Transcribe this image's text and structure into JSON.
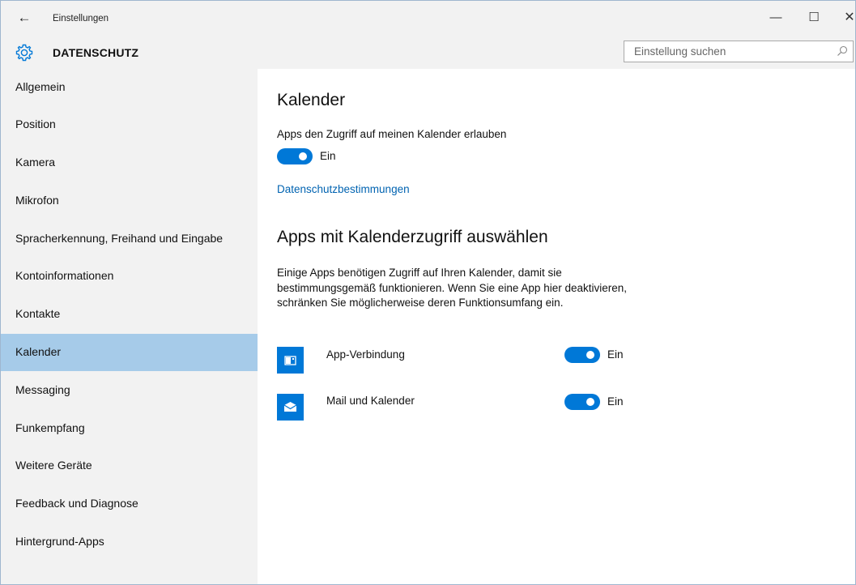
{
  "window": {
    "title": "Einstellungen",
    "back_glyph": "←",
    "minimize_glyph": "—",
    "maximize_glyph": "☐",
    "close_glyph": "✕"
  },
  "header": {
    "title": "DATENSCHUTZ",
    "icon": "gear-icon",
    "search_placeholder": "Einstellung suchen",
    "search_value": ""
  },
  "sidebar": {
    "selected_index": 7,
    "items": [
      {
        "label": "Allgemein"
      },
      {
        "label": "Position"
      },
      {
        "label": "Kamera"
      },
      {
        "label": "Mikrofon"
      },
      {
        "label": "Spracherkennung, Freihand und Eingabe"
      },
      {
        "label": "Kontoinformationen"
      },
      {
        "label": "Kontakte"
      },
      {
        "label": "Kalender"
      },
      {
        "label": "Messaging"
      },
      {
        "label": "Funkempfang"
      },
      {
        "label": "Weitere Geräte"
      },
      {
        "label": "Feedback und Diagnose"
      },
      {
        "label": "Hintergrund-Apps"
      }
    ]
  },
  "main": {
    "section_title": "Kalender",
    "access_label": "Apps den Zugriff auf meinen Kalender erlauben",
    "access_toggle": {
      "state": "Ein",
      "on": true
    },
    "privacy_link": "Datenschutzbestimmungen",
    "apps_title": "Apps mit Kalenderzugriff auswählen",
    "apps_description": "Einige Apps benötigen Zugriff auf Ihren Kalender, damit sie bestimmungsgemäß funktionieren. Wenn Sie eine App hier deaktivieren, schränken Sie möglicherweise deren Funktionsumfang ein.",
    "apps": [
      {
        "name": "App-Verbindung",
        "icon": "app-connector-icon",
        "toggle": "Ein",
        "on": true
      },
      {
        "name": "Mail und Kalender",
        "icon": "mail-icon",
        "toggle": "Ein",
        "on": true
      }
    ]
  },
  "colors": {
    "accent": "#0078d7",
    "selected_nav": "#a6cbe9",
    "link": "#0063b1",
    "chrome_bg": "#f2f2f2"
  }
}
